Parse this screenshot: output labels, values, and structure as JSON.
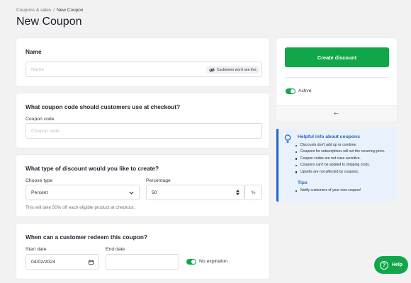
{
  "breadcrumb": {
    "parent": "Coupons & sales",
    "separator": "/",
    "current": "New Coupon"
  },
  "page_title": "New Coupon",
  "name_section": {
    "heading": "Name",
    "input_placeholder": "Name",
    "badge_text": "Customers won't see this",
    "badge_icon": "eye-off-icon"
  },
  "code_section": {
    "heading": "What coupon code should customers use at checkout?",
    "label": "Coupon code",
    "input_placeholder": "Coupon code"
  },
  "discount_section": {
    "heading": "What type of discount would you like to create?",
    "type_label": "Choose type",
    "type_value": "Percent",
    "percentage_label": "Percentage",
    "percentage_value": "50",
    "percent_suffix": "%",
    "hint": "This will take 50% off each eligible product at checkout."
  },
  "redeem_section": {
    "heading": "When can a customer redeem this coupon?",
    "start_label": "Start date",
    "start_value": "04/02/2024",
    "end_label": "End date",
    "end_placeholder": "",
    "no_expiration_label": "No expiration",
    "no_expiration_on": true
  },
  "side_panel": {
    "create_button": "Create discount",
    "active_label": "Active",
    "active_on": true,
    "back_icon": "arrow-left-icon"
  },
  "info_box": {
    "heading": "Helpful info about coupons",
    "icon": "lightbulb-icon",
    "items": [
      "Discounts don't add up or combine.",
      "Coupons for subscriptions will set the recurring price.",
      "Coupon codes are not case sensitive.",
      "Coupons can't be applied to shipping costs.",
      "Upsells are not affected by coupons."
    ],
    "tips_heading": "Tips",
    "tips_items": [
      "Notify customers of your new coupon!"
    ]
  },
  "help_button": {
    "label": "Help",
    "icon": "question-icon"
  },
  "colors": {
    "accent_green": "#10a64a",
    "info_blue": "#1e63c9",
    "info_bg": "#e9f2fc"
  }
}
